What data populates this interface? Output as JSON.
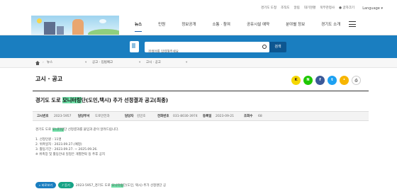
{
  "utility": {
    "links": [
      "경기도 도청",
      "조직도",
      "알림",
      "대기현황",
      "북부관청사",
      "글자크기"
    ],
    "language": "Language"
  },
  "gnb": {
    "menu": [
      "뉴스",
      "민원",
      "정보공개",
      "소통 · 참여",
      "공유시설 예약",
      "분야별 정보",
      "경기도 소개"
    ],
    "active_index": 0
  },
  "search": {
    "placeholder": "검색어를 입력해주세요",
    "button": "검색"
  },
  "breadcrumb": [
    "뉴스",
    "공고 · 입법예고",
    "고시 · 공고"
  ],
  "page": {
    "title": "고시 · 공고"
  },
  "share": {
    "icons": [
      "kakao-icon",
      "naver-icon",
      "facebook-icon",
      "twitter-icon",
      "share-icon",
      "print-icon"
    ],
    "labels": [
      "K",
      "N",
      "f",
      "t",
      "•",
      "⎙"
    ]
  },
  "post": {
    "title_pre": "경기도 도로 ",
    "title_hl": "모니터링",
    "title_post": "단(도민,택시) 추가 선정결과 공고(최종)",
    "meta": {
      "no_label": "고시번호",
      "no": "2023-5957",
      "dept_label": "담당부서",
      "dept": "도로안전과",
      "person_label": "담당자",
      "person": "김민호",
      "phone_label": "전화번호",
      "phone": "031-8030-3974",
      "date_label": "등록일",
      "date": "2023-09-21",
      "views_label": "조회수",
      "views": "68"
    },
    "body": {
      "intro_pre": "경기도 도로 ",
      "intro_hl": "모니터링",
      "intro_post": "단 선정결과를 붙임과 같이 알려드립니다.",
      "items": [
        "1. 선정인원 : 11명",
        "2. 위촉일자 : 2023.09.27.(예정)",
        "3. 활동기간 : 2023.09.27. ~ 2025.09.26.",
        "※ 위촉장 및 활동안내 일정은 개별연락 등 추후 공지"
      ]
    },
    "attachment": {
      "preview": "바로보기",
      "download": "듣기",
      "file_pre": "2023-5957_경기도 도로 ",
      "file_hl": "모니터링",
      "file_post": "단(도민, 택시) 추가 선정명단 공"
    }
  }
}
